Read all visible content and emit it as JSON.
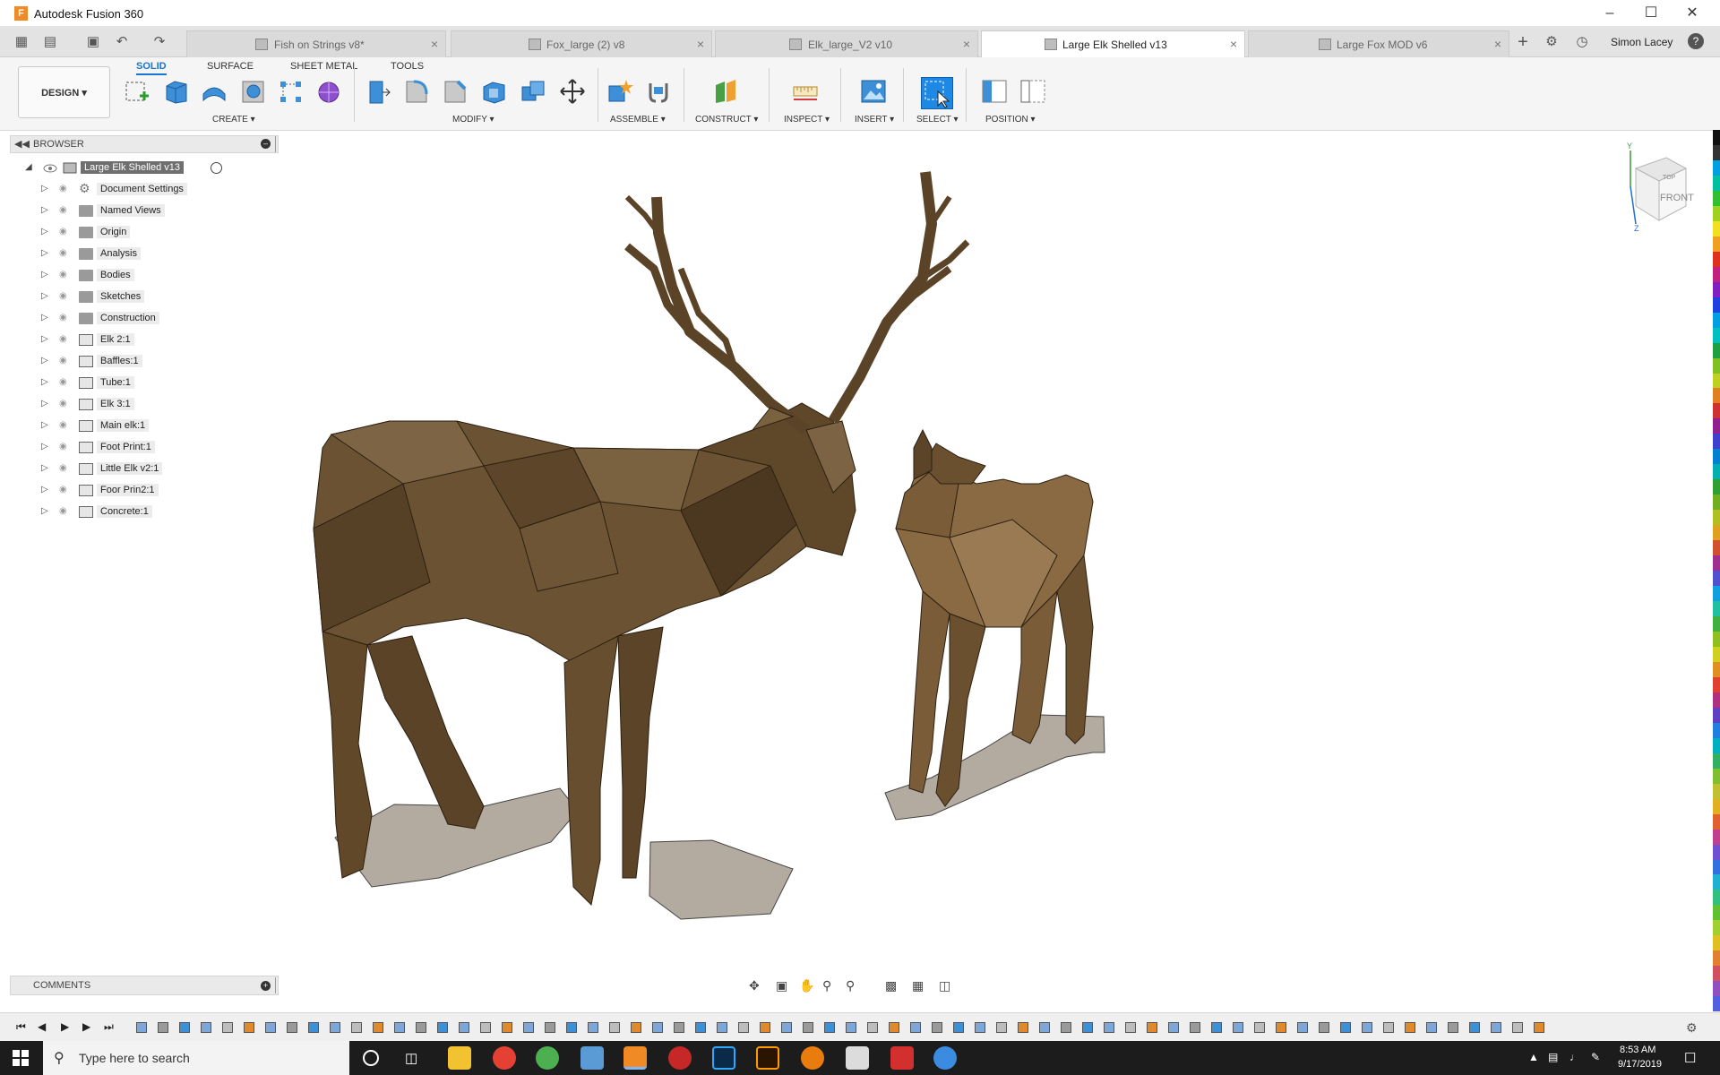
{
  "window": {
    "title": "Autodesk Fusion 360"
  },
  "tabs": [
    {
      "label": "Fish on Strings v8*",
      "active": false
    },
    {
      "label": "Fox_large (2) v8",
      "active": false
    },
    {
      "label": "Elk_large_V2 v10",
      "active": false
    },
    {
      "label": "Large Elk Shelled v13",
      "active": true
    },
    {
      "label": "Large Fox MOD v6",
      "active": false
    }
  ],
  "user": {
    "name": "Simon Lacey"
  },
  "workspace": {
    "label": "DESIGN ▾"
  },
  "ribbon_tabs": [
    "SOLID",
    "SURFACE",
    "SHEET METAL",
    "TOOLS"
  ],
  "ribbon_groups": [
    "CREATE ▾",
    "MODIFY ▾",
    "ASSEMBLE ▾",
    "CONSTRUCT ▾",
    "INSPECT ▾",
    "INSERT ▾",
    "SELECT ▾",
    "POSITION ▾"
  ],
  "browser": {
    "title": "BROWSER",
    "root": "Large Elk Shelled v13",
    "items": [
      {
        "label": "Document Settings",
        "icon": "gear-icon"
      },
      {
        "label": "Named Views",
        "icon": "folder-icon"
      },
      {
        "label": "Origin",
        "icon": "folder-icon"
      },
      {
        "label": "Analysis",
        "icon": "folder-icon"
      },
      {
        "label": "Bodies",
        "icon": "folder-icon"
      },
      {
        "label": "Sketches",
        "icon": "folder-icon"
      },
      {
        "label": "Construction",
        "icon": "folder-icon"
      },
      {
        "label": "Elk 2:1",
        "icon": "component-icon"
      },
      {
        "label": "Baffles:1",
        "icon": "component-icon"
      },
      {
        "label": "Tube:1",
        "icon": "component-icon"
      },
      {
        "label": "Elk 3:1",
        "icon": "component-icon"
      },
      {
        "label": "Main elk:1",
        "icon": "component-icon"
      },
      {
        "label": "Foot Print:1",
        "icon": "component-icon"
      },
      {
        "label": "Little Elk v2:1",
        "icon": "component-icon"
      },
      {
        "label": "Foor Prin2:1",
        "icon": "component-icon"
      },
      {
        "label": "Concrete:1",
        "icon": "component-icon"
      }
    ]
  },
  "comments": {
    "title": "COMMENTS"
  },
  "viewcube": {
    "face": "FRONT",
    "top": "TOP"
  },
  "taskbar": {
    "search_placeholder": "Type here to search",
    "time": "8:53 AM",
    "date": "9/17/2019"
  },
  "colors": {
    "accent": "#1776d3",
    "model": "#6b5233",
    "base": "#b3aba0",
    "app": "#f08a24"
  }
}
